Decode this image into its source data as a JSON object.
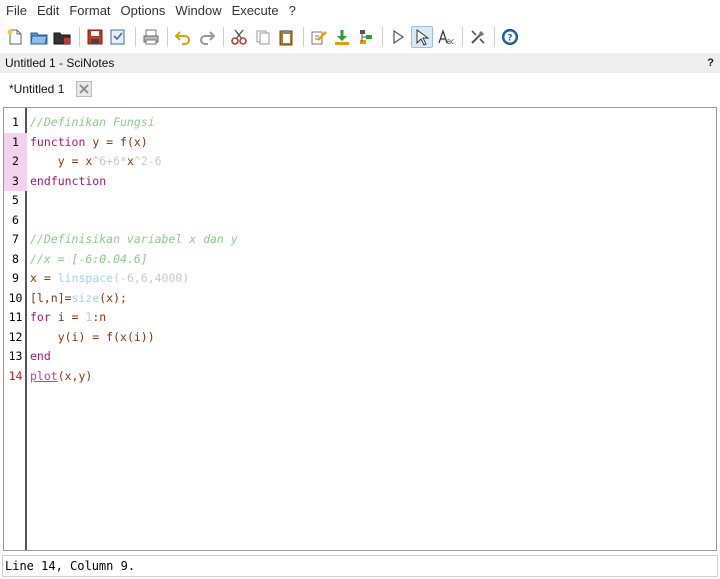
{
  "menu": [
    "File",
    "Edit",
    "Format",
    "Options",
    "Window",
    "Execute",
    "?"
  ],
  "toolbar": {
    "icons": [
      "new-file-icon",
      "open-file-icon",
      "open-recent-icon",
      "save-icon",
      "save-as-icon",
      "print-icon",
      "undo-icon",
      "redo-icon",
      "cut-icon",
      "copy-icon",
      "paste-icon",
      "find-icon",
      "load-into-scilab-icon",
      "execute-options-icon",
      "run-icon",
      "select-icon",
      "abc-icon",
      "settings-icon",
      "help-icon"
    ]
  },
  "window": {
    "title": "Untitled 1 - SciNotes",
    "help": "?"
  },
  "tab": {
    "label": "*Untitled 1"
  },
  "editor": {
    "gutter": [
      "1",
      "1",
      "2",
      "3",
      "5",
      "6",
      "7",
      "8",
      "9",
      "10",
      "11",
      "12",
      "13",
      "14"
    ],
    "lines": [
      [
        {
          "t": "//Definikan Fungsi",
          "c": "comment"
        }
      ],
      [
        {
          "t": "function",
          "c": "kw"
        },
        {
          "t": " y = ",
          "c": "var"
        },
        {
          "t": "f",
          "c": "fnname"
        },
        {
          "t": "(x)",
          "c": "var"
        }
      ],
      [
        {
          "t": "    y = ",
          "c": "var"
        },
        {
          "t": "x",
          "c": "var"
        },
        {
          "t": "^6+6*",
          "c": "fade"
        },
        {
          "t": "x",
          "c": "var"
        },
        {
          "t": "^2-6",
          "c": "fade"
        }
      ],
      [
        {
          "t": "endfunction",
          "c": "kw"
        }
      ],
      [],
      [],
      [
        {
          "t": "//Definisikan variabel x dan y",
          "c": "comment"
        }
      ],
      [
        {
          "t": "//x = [-6:0.04.6]",
          "c": "comment"
        }
      ],
      [
        {
          "t": "x = ",
          "c": "var"
        },
        {
          "t": "linspace",
          "c": "builtin"
        },
        {
          "t": "(-6,6,4000)",
          "c": "fade"
        }
      ],
      [
        {
          "t": "[l,n]=",
          "c": "var"
        },
        {
          "t": "size",
          "c": "builtin"
        },
        {
          "t": "(x);",
          "c": "var"
        }
      ],
      [
        {
          "t": "for",
          "c": "kw"
        },
        {
          "t": " i = ",
          "c": "var"
        },
        {
          "t": "1",
          "c": "fade"
        },
        {
          "t": ":n",
          "c": "var"
        }
      ],
      [
        {
          "t": "    y(i) = ",
          "c": "var"
        },
        {
          "t": "f",
          "c": "fnname"
        },
        {
          "t": "(x(i))",
          "c": "var"
        }
      ],
      [
        {
          "t": "end",
          "c": "kw"
        }
      ],
      [
        {
          "t": "plot",
          "c": "plot"
        },
        {
          "t": "(x,y)",
          "c": "var"
        }
      ]
    ]
  },
  "status": {
    "text": "Line 14, Column 9."
  }
}
